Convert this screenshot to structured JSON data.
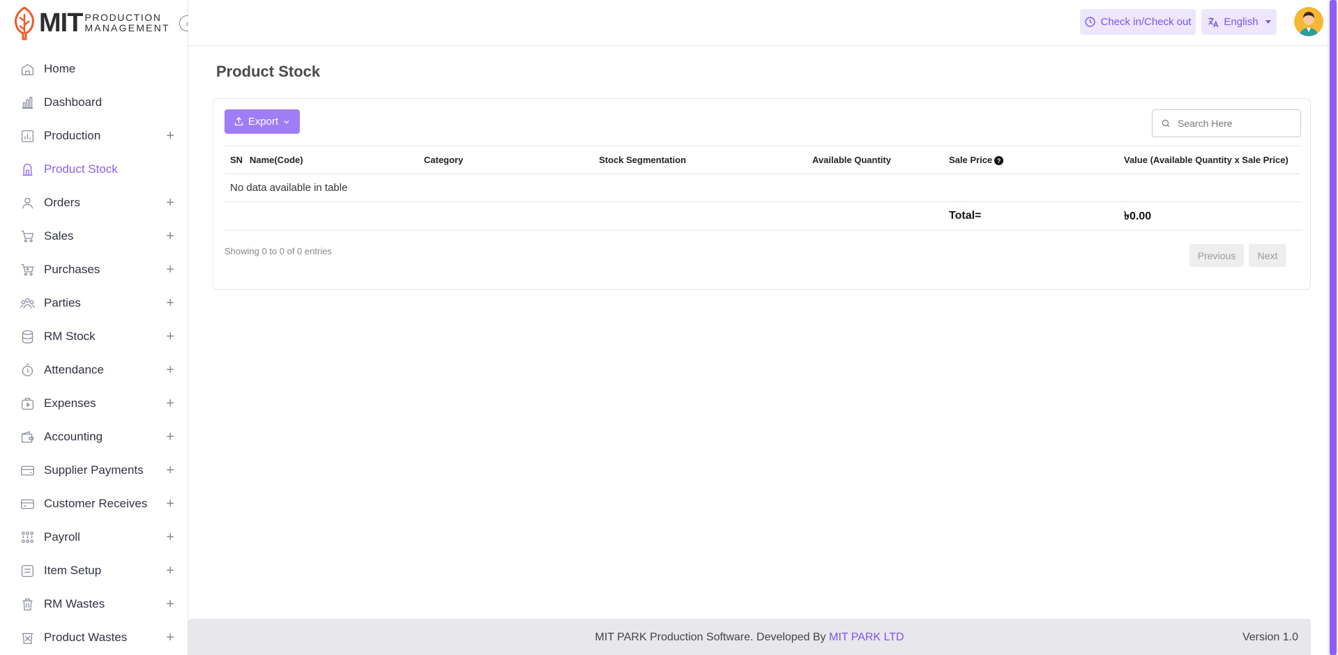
{
  "brand": {
    "mark": "MIT",
    "line1": "PRODUCTION",
    "line2": "MANAGEMENT",
    "accent_color": "#8d5df5",
    "logo_color": "#f05a28"
  },
  "sidebar": {
    "items": [
      {
        "label": "Home",
        "icon": "home-icon",
        "expandable": false
      },
      {
        "label": "Dashboard",
        "icon": "bar-chart-icon",
        "expandable": false
      },
      {
        "label": "Production",
        "icon": "production-chart-icon",
        "expandable": true
      },
      {
        "label": "Product Stock",
        "icon": "product-stock-icon",
        "expandable": false,
        "active": true
      },
      {
        "label": "Orders",
        "icon": "user-icon",
        "expandable": true
      },
      {
        "label": "Sales",
        "icon": "cart-icon",
        "expandable": true
      },
      {
        "label": "Purchases",
        "icon": "purchase-cart-icon",
        "expandable": true
      },
      {
        "label": "Parties",
        "icon": "users-icon",
        "expandable": true
      },
      {
        "label": "RM Stock",
        "icon": "database-icon",
        "expandable": true
      },
      {
        "label": "Attendance",
        "icon": "stopwatch-icon",
        "expandable": true
      },
      {
        "label": "Expenses",
        "icon": "money-bag-icon",
        "expandable": true
      },
      {
        "label": "Accounting",
        "icon": "wallet-icon",
        "expandable": true
      },
      {
        "label": "Supplier Payments",
        "icon": "card-payment-icon",
        "expandable": true
      },
      {
        "label": "Customer Receives",
        "icon": "card-receive-icon",
        "expandable": true
      },
      {
        "label": "Payroll",
        "icon": "payroll-icon",
        "expandable": true
      },
      {
        "label": "Item Setup",
        "icon": "item-setup-icon",
        "expandable": true
      },
      {
        "label": "RM Wastes",
        "icon": "trash-icon",
        "expandable": true
      },
      {
        "label": "Product Wastes",
        "icon": "waste-bin-icon",
        "expandable": true
      }
    ],
    "expand_symbol": "+"
  },
  "header": {
    "check_label": "Check in/Check out",
    "language_label": "English"
  },
  "main": {
    "title": "Product Stock",
    "export_label": "Export",
    "search_placeholder": "Search Here",
    "table": {
      "columns": [
        "SN",
        "Name(Code)",
        "Category",
        "Stock Segmentation",
        "Available Quantity",
        "Sale Price",
        "Value (Available Quantity x Sale Price)"
      ],
      "empty_message": "No data available in table",
      "total_label": "Total=",
      "total_value": "৳0.00"
    },
    "showing_text": "Showing 0 to 0 of 0 entries",
    "pagination": {
      "previous": "Previous",
      "next": "Next"
    }
  },
  "footer": {
    "text": "MIT PARK Production Software. Developed By ",
    "link": "MIT PARK LTD",
    "version": "Version 1.0"
  }
}
